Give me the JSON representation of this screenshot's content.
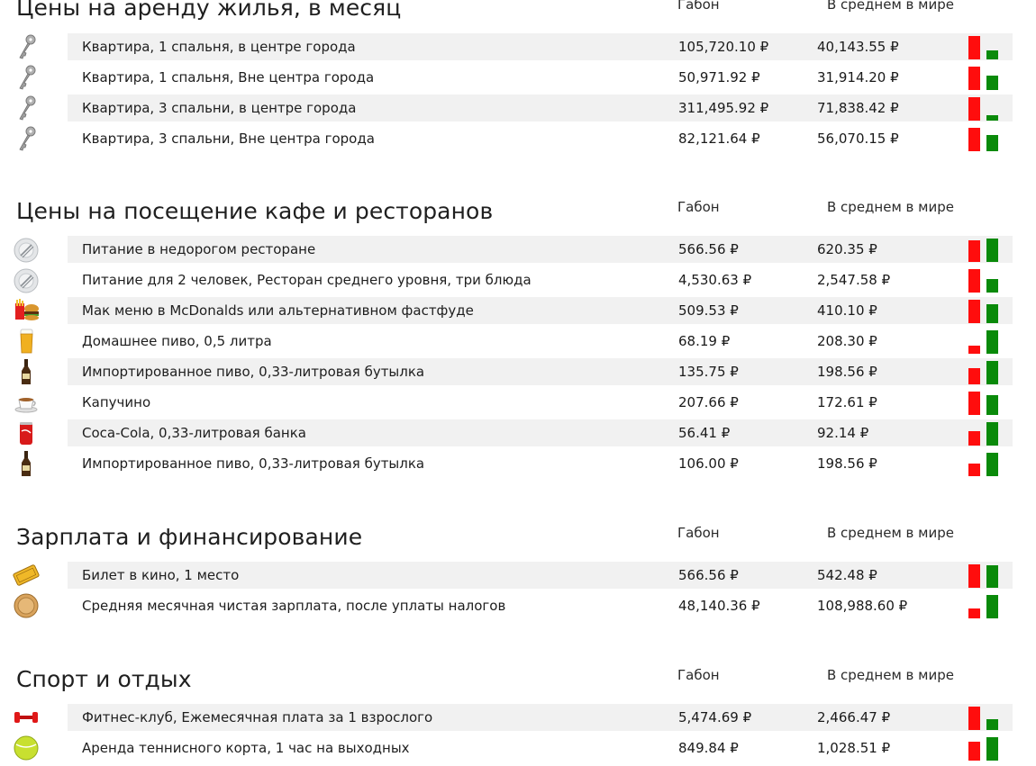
{
  "colors": {
    "red_bar": "#ff0d0d",
    "green_bar": "#0a8a0a",
    "row_shade": "#f1f1f1"
  },
  "columns": {
    "country": "Габон",
    "world": "В среднем в мире"
  },
  "sections": [
    {
      "title": "Цены на аренду жилья, в месяц",
      "rows": [
        {
          "icon": "key-icon",
          "label": "Квартира, 1 спальня, в центре города",
          "v1": "105,720.10 ₽",
          "v2": "40,143.55 ₽",
          "country_value": 105720.1,
          "world_value": 40143.55
        },
        {
          "icon": "key-icon",
          "label": "Квартира, 1 спальня, Вне центра города",
          "v1": "50,971.92 ₽",
          "v2": "31,914.20 ₽",
          "country_value": 50971.92,
          "world_value": 31914.2
        },
        {
          "icon": "key-icon",
          "label": "Квартира, 3 спальни, в центре города",
          "v1": "311,495.92 ₽",
          "v2": "71,838.42 ₽",
          "country_value": 311495.92,
          "world_value": 71838.42
        },
        {
          "icon": "key-icon",
          "label": "Квартира, 3 спальни, Вне центра города",
          "v1": "82,121.64 ₽",
          "v2": "56,070.15 ₽",
          "country_value": 82121.64,
          "world_value": 56070.15
        }
      ]
    },
    {
      "title": "Цены на посещение кафе и ресторанов",
      "rows": [
        {
          "icon": "plate-icon",
          "label": "Питание в недорогом ресторане",
          "v1": "566.56 ₽",
          "v2": "620.35 ₽",
          "country_value": 566.56,
          "world_value": 620.35
        },
        {
          "icon": "plate-icon",
          "label": "Питание для 2 человек, Ресторан среднего уровня, три блюда",
          "v1": "4,530.63 ₽",
          "v2": "2,547.58 ₽",
          "country_value": 4530.63,
          "world_value": 2547.58
        },
        {
          "icon": "fastfood-icon",
          "label": "Мак меню в McDonalds или альтернативном фастфуде",
          "v1": "509.53 ₽",
          "v2": "410.10 ₽",
          "country_value": 509.53,
          "world_value": 410.1
        },
        {
          "icon": "beer-glass-icon",
          "label": "Домашнее пиво, 0,5 литра",
          "v1": "68.19 ₽",
          "v2": "208.30 ₽",
          "country_value": 68.19,
          "world_value": 208.3
        },
        {
          "icon": "beer-bottle-icon",
          "label": "Импортированное пиво, 0,33-литровая бутылка",
          "v1": "135.75 ₽",
          "v2": "198.56 ₽",
          "country_value": 135.75,
          "world_value": 198.56
        },
        {
          "icon": "coffee-cup-icon",
          "label": "Капучино",
          "v1": "207.66 ₽",
          "v2": "172.61 ₽",
          "country_value": 207.66,
          "world_value": 172.61
        },
        {
          "icon": "cola-can-icon",
          "label": "Coca-Cola, 0,33-литровая банка",
          "v1": "56.41 ₽",
          "v2": "92.14 ₽",
          "country_value": 56.41,
          "world_value": 92.14
        },
        {
          "icon": "beer-bottle-icon",
          "label": "Импортированное пиво, 0,33-литровая бутылка",
          "v1": "106.00 ₽",
          "v2": "198.56 ₽",
          "country_value": 106.0,
          "world_value": 198.56
        }
      ]
    },
    {
      "title": "Зарплата и финансирование",
      "rows": [
        {
          "icon": "cinema-ticket-icon",
          "label": "Билет в кино, 1 место",
          "v1": "566.56 ₽",
          "v2": "542.48 ₽",
          "country_value": 566.56,
          "world_value": 542.48
        },
        {
          "icon": "coin-icon",
          "label": "Средняя месячная чистая зарплата, после уплаты налогов",
          "v1": "48,140.36 ₽",
          "v2": "108,988.60 ₽",
          "country_value": 48140.36,
          "world_value": 108988.6
        }
      ]
    },
    {
      "title": "Спорт и отдых",
      "rows": [
        {
          "icon": "dumbbell-icon",
          "label": "Фитнес-клуб, Ежемесячная плата за 1 взрослого",
          "v1": "5,474.69 ₽",
          "v2": "2,466.47 ₽",
          "country_value": 5474.69,
          "world_value": 2466.47
        },
        {
          "icon": "tennis-ball-icon",
          "label": "Аренда теннисного корта, 1 час на выходных",
          "v1": "849.84 ₽",
          "v2": "1,028.51 ₽",
          "country_value": 849.84,
          "world_value": 1028.51
        }
      ]
    }
  ]
}
